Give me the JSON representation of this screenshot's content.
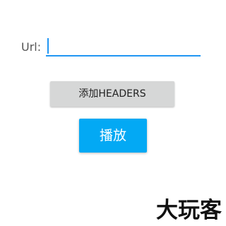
{
  "form": {
    "url_label": "Url:",
    "url_value": "",
    "url_placeholder": ""
  },
  "buttons": {
    "add_headers_label": "添加HEADERS",
    "play_label": "播放"
  },
  "watermark": {
    "text": "大玩客"
  },
  "colors": {
    "accent": "#2196f3",
    "play_button": "#03a9f4",
    "secondary_button": "#d6d7d7"
  }
}
